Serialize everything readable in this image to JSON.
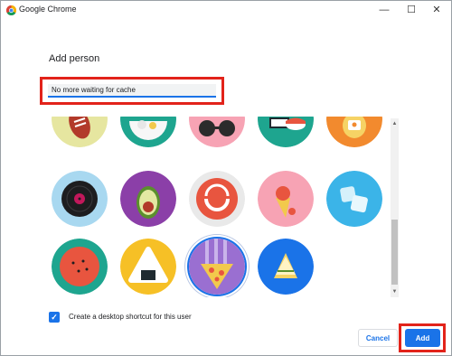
{
  "window": {
    "title": "Google Chrome",
    "controls": {
      "minimize": "—",
      "maximize": "☐",
      "close": "✕"
    }
  },
  "dialog": {
    "heading": "Add person",
    "name_value": "No more waiting for cache",
    "avatars": [
      "football",
      "noodle-bowl",
      "sunglasses",
      "sushi",
      "tamagotchi",
      "vinyl-record",
      "avocado",
      "smile",
      "ice-cream",
      "ice-cubes",
      "watermelon",
      "onigiri",
      "pizza",
      "sandwich"
    ],
    "selected_avatar": "pizza",
    "shortcut_checked": true,
    "shortcut_label": "Create a desktop shortcut for this user",
    "cancel_label": "Cancel",
    "add_label": "Add"
  },
  "colors": {
    "accent": "#1a73e8",
    "highlight": "#e2231a"
  }
}
